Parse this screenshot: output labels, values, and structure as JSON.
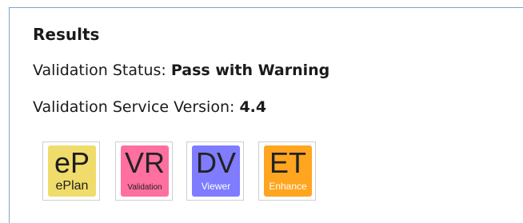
{
  "results": {
    "heading": "Results",
    "status_label": "Validation Status: ",
    "status_value": "Pass with Warning",
    "version_label": "Validation Service Version: ",
    "version_value": "4.4"
  },
  "apps": [
    {
      "abbr": "eP",
      "label": "ePlan",
      "color": "#f0dc6a",
      "icon": "eplan-app-icon"
    },
    {
      "abbr": "VR",
      "label": "Validation",
      "color": "#ff6fa0",
      "icon": "validation-app-icon"
    },
    {
      "abbr": "DV",
      "label": "Viewer",
      "color": "#7f7cff",
      "icon": "viewer-app-icon"
    },
    {
      "abbr": "ET",
      "label": "Enhance",
      "color": "#ffa51f",
      "icon": "enhance-app-icon"
    }
  ],
  "colors": {
    "panel_border": "#7ea6cf"
  }
}
